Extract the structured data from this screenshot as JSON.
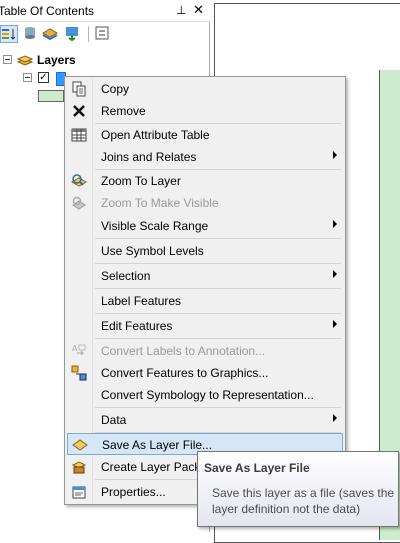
{
  "toc": {
    "title": "Table Of Contents",
    "pin_glyph": "⊥",
    "close_glyph": "✕",
    "toolbar": [
      {
        "icon": "list-by-drawing-order-icon"
      },
      {
        "icon": "list-by-source-icon"
      },
      {
        "icon": "list-by-visibility-icon"
      },
      {
        "icon": "list-by-selection-icon"
      },
      {
        "icon": "options-icon"
      }
    ],
    "root_label": "Layers",
    "layer_checked": "✓"
  },
  "menu": {
    "items": [
      {
        "label": "Copy",
        "icon": "copy-icon",
        "enabled": true
      },
      {
        "label": "Remove",
        "icon": "remove-icon",
        "enabled": true
      },
      {
        "label": "Open Attribute Table",
        "icon": "table-icon",
        "enabled": true
      },
      {
        "label": "Joins and Relates",
        "icon": "",
        "enabled": true,
        "submenu": true
      },
      {
        "label": "Zoom To Layer",
        "icon": "zoom-to-layer-icon",
        "enabled": true
      },
      {
        "label": "Zoom To Make Visible",
        "icon": "zoom-to-visible-icon",
        "enabled": false
      },
      {
        "label": "Visible Scale Range",
        "icon": "",
        "enabled": true,
        "submenu": true
      },
      {
        "label": "Use Symbol Levels",
        "icon": "",
        "enabled": true
      },
      {
        "label": "Selection",
        "icon": "",
        "enabled": true,
        "submenu": true
      },
      {
        "label": "Label Features",
        "icon": "",
        "enabled": true
      },
      {
        "label": "Edit Features",
        "icon": "",
        "enabled": true,
        "submenu": true
      },
      {
        "label": "Convert Labels to Annotation...",
        "icon": "convert-labels-icon",
        "enabled": false
      },
      {
        "label": "Convert Features to Graphics...",
        "icon": "convert-graphics-icon",
        "enabled": true
      },
      {
        "label": "Convert Symbology to Representation...",
        "icon": "",
        "enabled": true
      },
      {
        "label": "Data",
        "icon": "",
        "enabled": true,
        "submenu": true
      },
      {
        "label": "Save As Layer File...",
        "icon": "layer-file-icon",
        "enabled": true,
        "highlighted": true
      },
      {
        "label": "Create Layer Packa",
        "icon": "layer-package-icon",
        "enabled": true
      },
      {
        "label": "Properties...",
        "icon": "properties-icon",
        "enabled": true
      }
    ]
  },
  "tooltip": {
    "title": "Save As Layer File",
    "body": "Save this layer as a file (saves the layer definition not the data)"
  }
}
